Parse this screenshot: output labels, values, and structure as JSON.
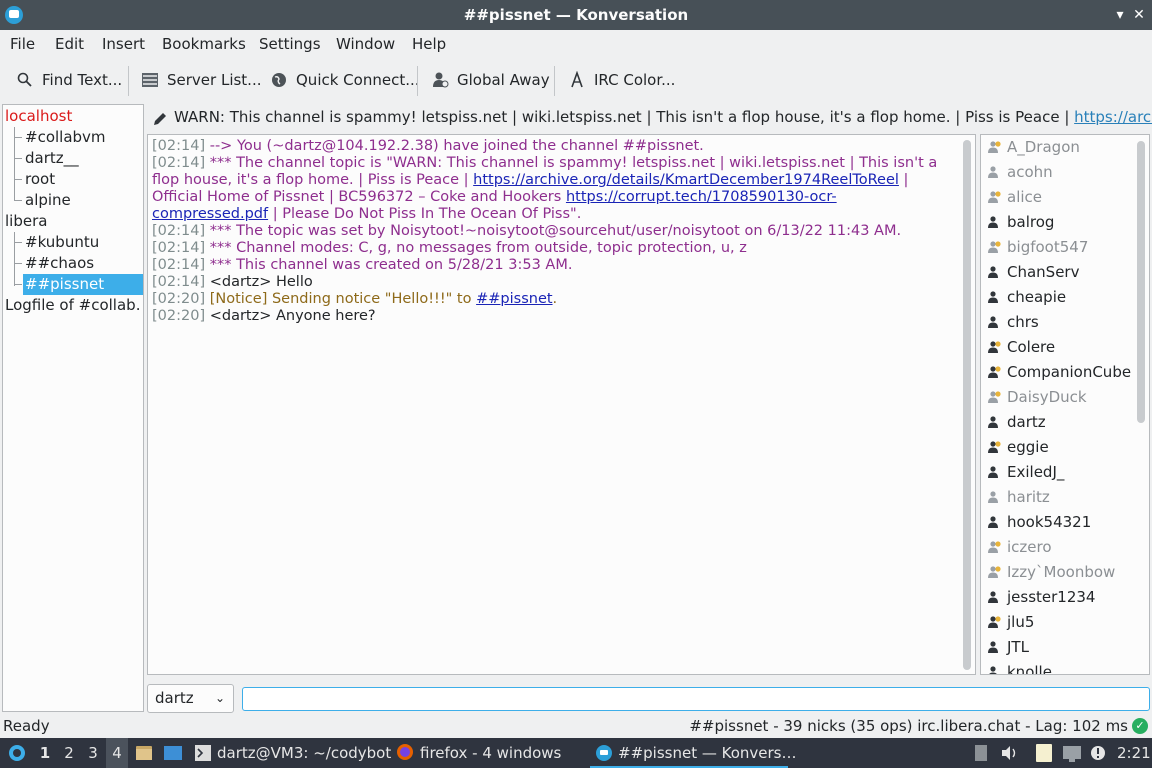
{
  "window": {
    "title": "##pissnet — Konversation",
    "buttons": [
      "▾",
      "✕"
    ]
  },
  "menu": [
    "File",
    "Edit",
    "Insert",
    "Bookmarks",
    "Settings",
    "Window",
    "Help"
  ],
  "toolbar": {
    "find_text": "Find Text...",
    "server_list": "Server List...",
    "quick_connect": "Quick Connect...",
    "global_away": "Global Away",
    "irc_color": "IRC Color..."
  },
  "tree": {
    "items": [
      {
        "label": "localhost",
        "level": 0,
        "style": "red"
      },
      {
        "label": "#collabvm",
        "level": 1
      },
      {
        "label": "dartz__",
        "level": 1
      },
      {
        "label": "root",
        "level": 1
      },
      {
        "label": "alpine",
        "level": 1
      },
      {
        "label": "libera",
        "level": 0
      },
      {
        "label": "#kubuntu",
        "level": 1
      },
      {
        "label": "##chaos",
        "level": 1
      },
      {
        "label": "##pissnet",
        "level": 1,
        "selected": true
      },
      {
        "label": "Logfile of #collab…",
        "level": 0
      }
    ]
  },
  "topic": {
    "text": "WARN: This channel is spammy! letspiss.net | wiki.letspiss.net | This isn't a flop house, it's a flop home. | Piss is Peace | ",
    "link": "https://archive.org/det…"
  },
  "chat": {
    "l1_ts": "[02:14]",
    "l1_text": "--> You (~dartz@104.192.2.38) have joined the channel ##pissnet.",
    "l2_ts": "[02:14]",
    "l2_a": "*** The channel topic is \"WARN: This channel is spammy! letspiss.net | wiki.letspiss.net | This isn't a flop house, it's a flop home. | Piss is Peace | ",
    "l2_link1": "https://archive.org/details/KmartDecember1974ReelToReel",
    "l2_b": " | Official Home of Pissnet | BC596372 – Coke and Hookers ",
    "l2_link2": "https://corrupt.tech/1708590130-ocr-compressed.pdf",
    "l2_c": " | Please Do Not Piss In The Ocean Of Piss\".",
    "l3_ts": "[02:14]",
    "l3_text": "*** The topic was set by Noisytoot!~noisytoot@sourcehut/user/noisytoot on 6/13/22 11:43 AM.",
    "l4_ts": "[02:14]",
    "l4_text": "*** Channel modes: C, g, no messages from outside, topic protection, u, z",
    "l5_ts": "[02:14]",
    "l5_text": "*** This channel was created on 5/28/21 3:53 AM.",
    "l6_ts": "[02:14]",
    "l6_text": "<dartz> Hello",
    "l7_ts": "[02:20]",
    "l7_tag": "[Notice]",
    "l7_text": " Sending notice \"Hello!!!\" to ",
    "l7_link": "##pissnet",
    "l7_end": ".",
    "l8_ts": "[02:20]",
    "l8_text": "<dartz> Anyone here?"
  },
  "nicks": [
    {
      "name": "A_Dragon",
      "away": true,
      "op": true
    },
    {
      "name": "acohn",
      "away": true,
      "op": false
    },
    {
      "name": "alice",
      "away": true,
      "op": true
    },
    {
      "name": "balrog",
      "away": false,
      "op": false
    },
    {
      "name": "bigfoot547",
      "away": true,
      "op": true
    },
    {
      "name": "ChanServ",
      "away": false,
      "op": false
    },
    {
      "name": "cheapie",
      "away": false,
      "op": false
    },
    {
      "name": "chrs",
      "away": false,
      "op": false
    },
    {
      "name": "Colere",
      "away": false,
      "op": true
    },
    {
      "name": "CompanionCube",
      "away": false,
      "op": true
    },
    {
      "name": "DaisyDuck",
      "away": true,
      "op": true
    },
    {
      "name": "dartz",
      "away": false,
      "op": false
    },
    {
      "name": "eggie",
      "away": false,
      "op": true
    },
    {
      "name": "ExiledJ_",
      "away": false,
      "op": false
    },
    {
      "name": "haritz",
      "away": true,
      "op": false
    },
    {
      "name": "hook54321",
      "away": false,
      "op": false
    },
    {
      "name": "iczero",
      "away": true,
      "op": true
    },
    {
      "name": "Izzy`Moonbow",
      "away": true,
      "op": true
    },
    {
      "name": "jesster1234",
      "away": false,
      "op": false
    },
    {
      "name": "jlu5",
      "away": false,
      "op": true
    },
    {
      "name": "JTL",
      "away": false,
      "op": false
    },
    {
      "name": "knolle",
      "away": false,
      "op": false
    }
  ],
  "input": {
    "nick": "dartz",
    "value": ""
  },
  "status": {
    "left": "Ready",
    "right": "##pissnet - 39 nicks (35 ops)  irc.libera.chat - Lag: 102 ms"
  },
  "taskbar": {
    "workspaces": [
      "1",
      "2",
      "3",
      "4"
    ],
    "task1": "dartz@VM3: ~/codybot",
    "task2": "firefox - 4 windows",
    "task3": "##pissnet — Konvers…",
    "clock": "2:21"
  },
  "colors": {
    "accent": "#3daee9",
    "system_message": "#8e2e8e",
    "timestamp": "#7f8c8d",
    "notice": "#8e6a1a",
    "link": "#1a24b6"
  }
}
